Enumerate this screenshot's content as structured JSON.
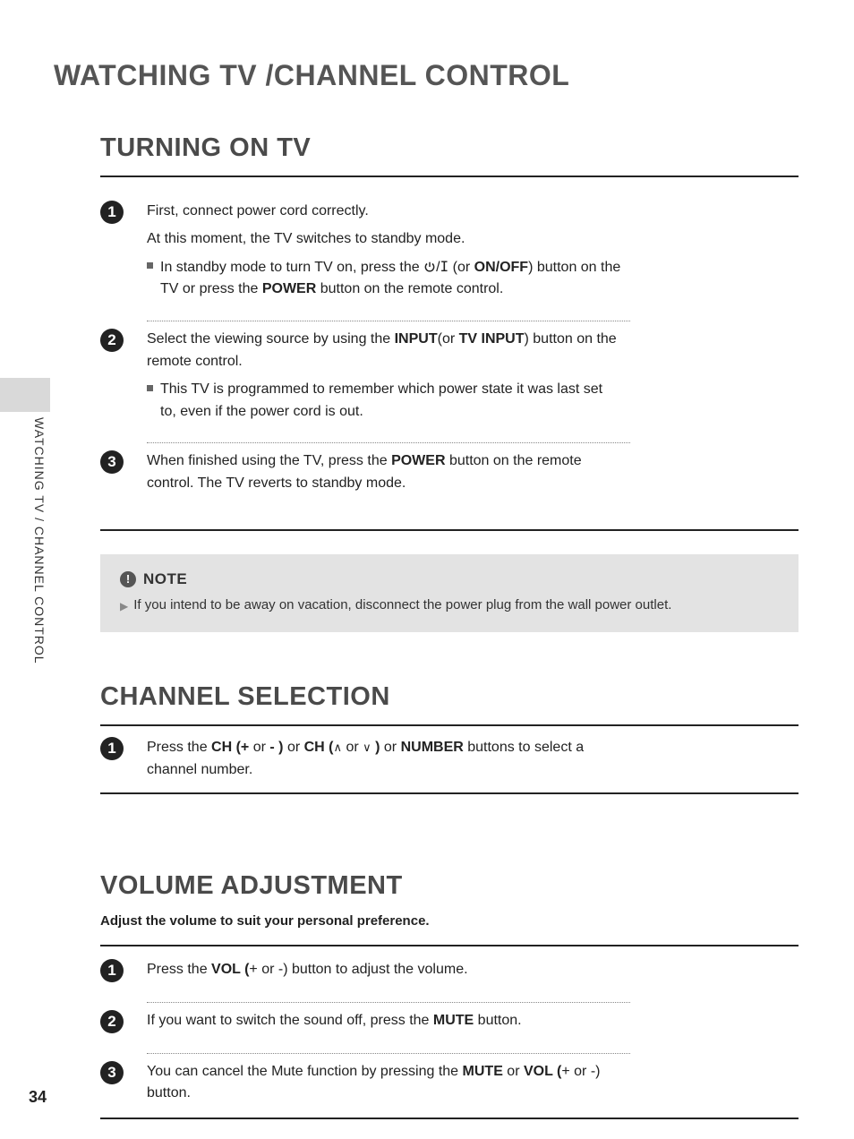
{
  "page": {
    "number": "34",
    "sideLabel": "WATCHING TV / CHANNEL CONTROL"
  },
  "mainTitle": "WATCHING TV /CHANNEL CONTROL",
  "turning": {
    "title": "TURNING ON TV",
    "step1": {
      "l1": "First, connect power cord correctly.",
      "l2": "At this moment, the TV switches to standby mode.",
      "b_a": "In standby mode to turn TV on, press the ",
      "b_b": " (or ",
      "onoff": "ON/OFF",
      "b_c": ") button on the TV or press the ",
      "power": "POWER",
      "b_d": " button on the remote control."
    },
    "step2": {
      "l1a": "Select the viewing source by using the ",
      "input": "INPUT",
      "l1b": "(or ",
      "tvinput": "TV INPUT",
      "l1c": ") button on the remote control.",
      "b": "This TV is programmed to remember which power state it was last set to, even if the power cord is out."
    },
    "step3": {
      "a": "When finished using the TV, press the ",
      "power": "POWER",
      "b": " button on the remote control. The TV reverts to standby mode."
    },
    "note": {
      "label": "NOTE",
      "text": "If you intend to be away on vacation, disconnect the power plug from the wall power outlet."
    }
  },
  "channel": {
    "title": "CHANNEL SELECTION",
    "step1": {
      "a": "Press the ",
      "ch1": "CH (",
      "plus": "+",
      "or1": " or ",
      "minus": "-",
      "cp1": " )",
      "or2": " or ",
      "ch2": "CH (",
      "or3": " or ",
      "cp2": " )",
      "or4": " or ",
      "num": "NUMBER",
      "b": " buttons to select a channel number."
    }
  },
  "volume": {
    "title": "VOLUME ADJUSTMENT",
    "intro": "Adjust the volume to suit your personal preference.",
    "step1": {
      "a": "Press the ",
      "vol": "VOL (",
      "b": "+ or -) button to adjust the volume."
    },
    "step2": {
      "a": "If you want to switch the sound off, press the ",
      "mute": "MUTE",
      "b": " button."
    },
    "step3": {
      "a": "You can cancel the Mute function by pressing the ",
      "mute": "MUTE",
      "or": " or ",
      "vol": "VOL (",
      "b": "+ or -) button."
    }
  }
}
